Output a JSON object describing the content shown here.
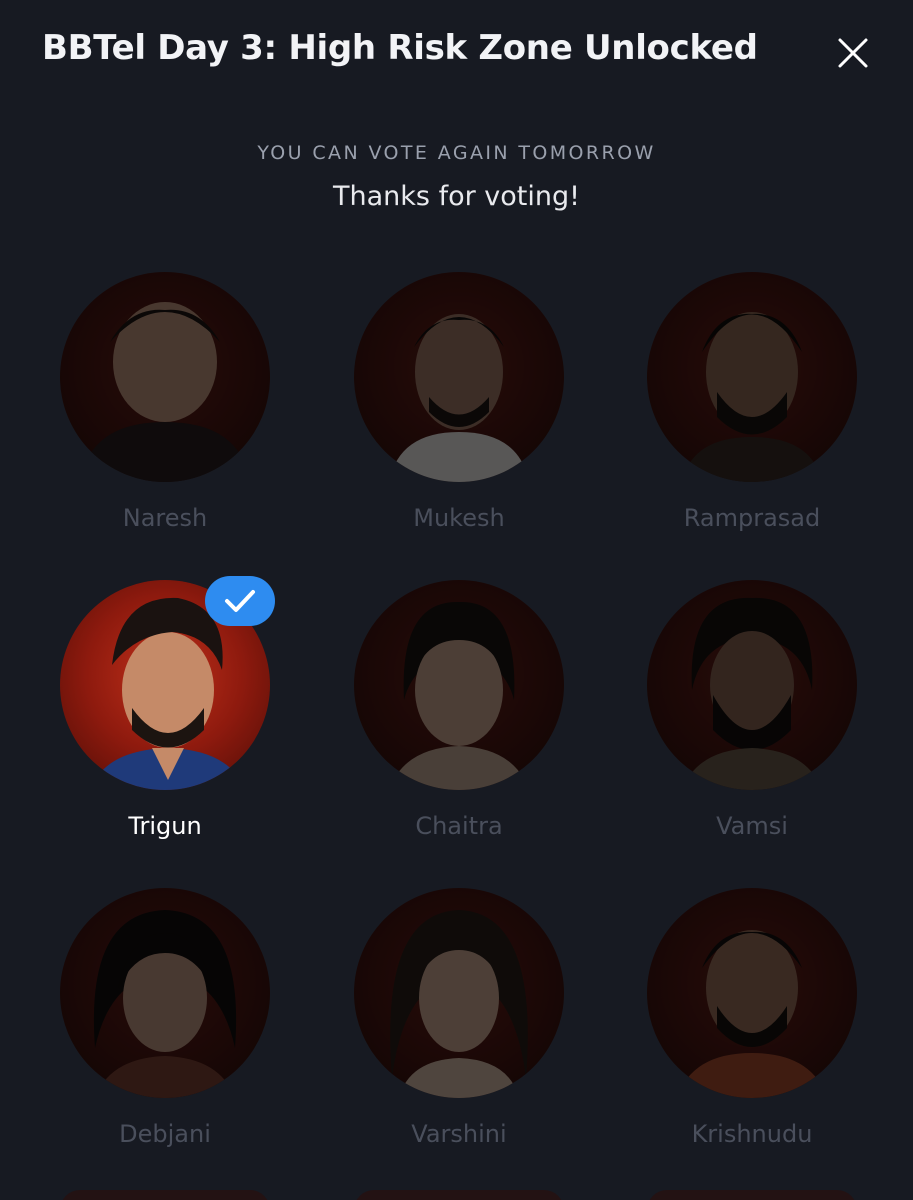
{
  "header": {
    "title": "BBTel Day 3: High Risk Zone Unlocked",
    "close_icon": "close-icon"
  },
  "status": {
    "notice": "YOU CAN VOTE AGAIN TOMORROW",
    "message": "Thanks for voting!"
  },
  "contestants": [
    {
      "name": "Naresh",
      "selected": false
    },
    {
      "name": "Mukesh",
      "selected": false
    },
    {
      "name": "Ramprasad",
      "selected": false
    },
    {
      "name": "Trigun",
      "selected": true
    },
    {
      "name": "Chaitra",
      "selected": false
    },
    {
      "name": "Vamsi",
      "selected": false
    },
    {
      "name": "Debjani",
      "selected": false
    },
    {
      "name": "Varshini",
      "selected": false
    },
    {
      "name": "Krishnudu",
      "selected": false
    }
  ],
  "colors": {
    "background": "#171a22",
    "accent": "#2e8cf0",
    "dim_text": "#4a4f5c",
    "selected_text": "#ffffff"
  },
  "icons": {
    "selected_badge": "checkmark-icon"
  }
}
